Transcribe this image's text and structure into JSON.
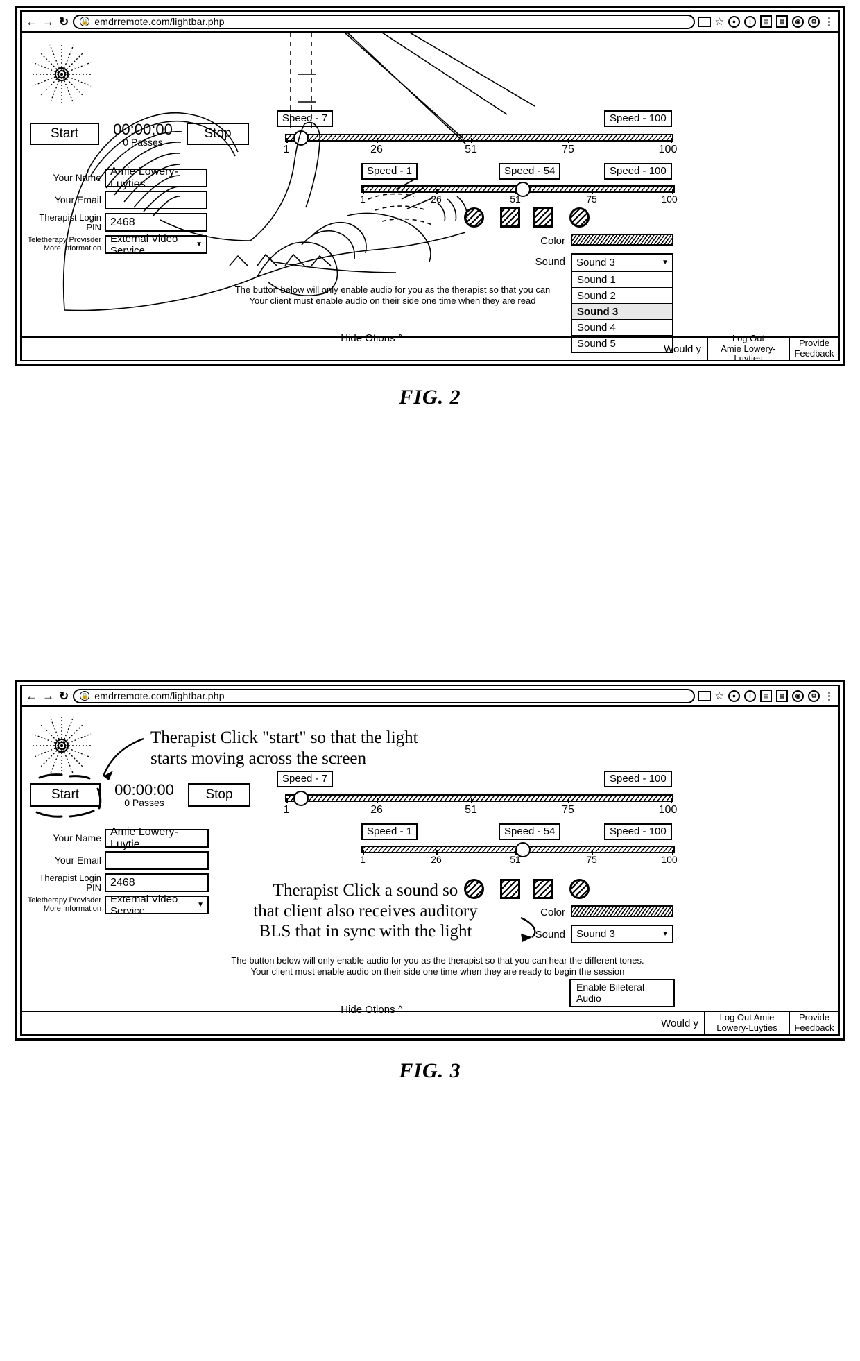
{
  "figures": [
    {
      "id": "fig2",
      "caption": "FIG. 2",
      "browser": {
        "back_icon": "back-arrow-icon",
        "forward_icon": "forward-arrow-icon",
        "reload_icon": "reload-icon",
        "lock_icon": "lock-icon",
        "url": "emdrremote.com/lightbar.php",
        "right_icons": [
          "cast-icon",
          "star-icon",
          "profile-icon",
          "info-icon",
          "extension-icon",
          "apps-icon",
          "account-icon",
          "settings-icon",
          "menu-icon"
        ]
      },
      "controls": {
        "start_label": "Start",
        "stop_label": "Stop",
        "timer": "00:00:00",
        "passes": "0 Passes"
      },
      "form": {
        "name_label": "Your Name",
        "name_value": "Amie Lowery-Luyties",
        "email_label": "Your Email",
        "email_value": "",
        "pin_label": "Therapist Login PIN",
        "pin_value": "2468",
        "provider_label": "Teletherapy Provisder",
        "provider_sub_label": "More Information",
        "provider_value": "External Video Service"
      },
      "sliders": [
        {
          "name": "speed-slider-top",
          "badge_left": "Speed - 7",
          "badge_right": "Speed - 100",
          "value": 7,
          "ticks": [
            "1",
            "26",
            "51",
            "75",
            "100"
          ]
        },
        {
          "name": "speed-slider-bottom",
          "badge_left": "Speed - 1",
          "badge_mid": "Speed - 54",
          "badge_right": "Speed - 100",
          "value": 54,
          "ticks": [
            "1",
            "26",
            "51",
            "75",
            "100"
          ]
        }
      ],
      "shapes": [
        "circle-hatched",
        "square-hatched",
        "square-hatched",
        "circle-hatched"
      ],
      "color_label": "Color",
      "sound_label": "Sound",
      "sound_value": "Sound 3",
      "sound_options": [
        "Sound 1",
        "Sound 2",
        "Sound 3",
        "Sound 4",
        "Sound 5"
      ],
      "help_text": "The button below will only enable audio for you as the therapist so that you can\nYour client must enable audio on their side one time when they are read",
      "hide_options": "Hide Otions",
      "footer": {
        "would_text": "Would y",
        "logout": "Log Out\nAmie Lowery-Luyties",
        "feedback": "Provide\nFeedback"
      }
    },
    {
      "id": "fig3",
      "caption": "FIG. 3",
      "browser": {
        "back_icon": "back-arrow-icon",
        "forward_icon": "forward-arrow-icon",
        "reload_icon": "reload-icon",
        "lock_icon": "lock-icon",
        "url": "emdrremote.com/lightbar.php",
        "right_icons": [
          "cast-icon",
          "star-icon",
          "profile-icon",
          "info-icon",
          "extension-icon",
          "apps-icon",
          "account-icon",
          "settings-icon",
          "menu-icon"
        ]
      },
      "controls": {
        "start_label": "Start",
        "stop_label": "Stop",
        "timer": "00:00:00",
        "passes": "0 Passes"
      },
      "form": {
        "name_label": "Your Name",
        "name_value": "Amie Lowery-Luytie",
        "email_label": "Your Email",
        "email_value": "",
        "pin_label": "Therapist Login PIN",
        "pin_value": "2468",
        "provider_label": "Teletherapy Provisder",
        "provider_sub_label": "More Information",
        "provider_value": "External Video Service"
      },
      "sliders": [
        {
          "name": "speed-slider-top",
          "badge_left": "Speed - 7",
          "badge_right": "Speed - 100",
          "value": 7,
          "ticks": [
            "1",
            "26",
            "51",
            "75",
            "100"
          ]
        },
        {
          "name": "speed-slider-bottom",
          "badge_left": "Speed - 1",
          "badge_mid": "Speed - 54",
          "badge_right": "Speed - 100",
          "value": 54,
          "ticks": [
            "1",
            "26",
            "51",
            "75",
            "100"
          ]
        }
      ],
      "shapes": [
        "circle-hatched",
        "square-hatched",
        "square-hatched",
        "circle-hatched"
      ],
      "color_label": "Color",
      "sound_label": "Sound",
      "sound_value": "Sound 3",
      "help_text": "The button below will only enable audio for you as the therapist so that you can hear the different tones.\nYour client must enable audio on their side one time when they are ready to begin the session",
      "enable_audio_label": "Enable Bileteral Audio",
      "hide_options": "Hide Otions",
      "footer": {
        "would_text": "Would y",
        "logout": "Log Out Amie\nLowery-Luyties",
        "feedback": "Provide\nFeedback"
      },
      "annotations": [
        {
          "name": "annotation-start-button",
          "text": "Therapist Click \"start\" so that the light\nstarts moving across the screen"
        },
        {
          "name": "annotation-sound-selection",
          "text": "Therapist Click a sound so\nthat client also receives auditory\nBLS that in sync with the light"
        }
      ]
    }
  ]
}
